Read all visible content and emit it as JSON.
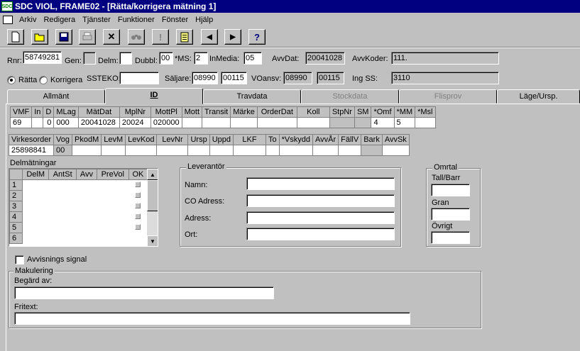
{
  "window": {
    "app_icon": "SDC",
    "title": "SDC VIOL, FRAME02 - [Rätta/korrigera mätning 1]"
  },
  "menu": [
    "Arkiv",
    "Redigera",
    "Tjänster",
    "Funktioner",
    "Fönster",
    "Hjälp"
  ],
  "toolbar": {
    "icons": [
      "new-document-icon",
      "open-folder-icon",
      "save-disk-icon",
      "print-icon",
      "delete-x-icon",
      "binoculars-icon",
      "exclamation-icon",
      "clipboard-icon",
      "arrow-left-icon",
      "arrow-right-icon",
      "help-question-icon"
    ],
    "glyphs": {
      "delete": "✕",
      "excl": "!",
      "prev": "◀",
      "next": "▶",
      "help": "?"
    }
  },
  "header": {
    "rnr_label": "Rnr:",
    "rnr_value": "58749281",
    "gen_label": "Gen:",
    "delm_label": "Delm:",
    "dubbl_label": "Dubbl:",
    "dubbl_value": "00",
    "ms_label": "*MS:",
    "ms_value": "2",
    "inmedia_label": "InMedia:",
    "inmedia_value": "05",
    "avvdat_label": "AvvDat:",
    "avvdat_value": "20041028",
    "avvkoder_label": "AvvKoder:",
    "avvkoder_value": "111.",
    "ratta_label": "Rätta",
    "korrigera_label": "Korrigera",
    "ssteko_label": "SSTEKO:",
    "ssteko_value": "",
    "saljare_label": "Säljare:",
    "saljare_value1": "08990",
    "saljare_value2": "00115",
    "voansv_label": "VOansv:",
    "voansv_value1": "08990",
    "voansv_value2": "00115",
    "ingss_label": "Ing SS:",
    "ingss_value": "3110"
  },
  "tabs": [
    {
      "label": "Allmänt",
      "state": "normal"
    },
    {
      "label": "ID",
      "state": "active"
    },
    {
      "label": "Travdata",
      "state": "normal"
    },
    {
      "label": "Stockdata",
      "state": "disabled"
    },
    {
      "label": "Flisprov",
      "state": "disabled"
    },
    {
      "label": "Läge/Ursp.",
      "state": "normal"
    }
  ],
  "grid1": {
    "headers": [
      "VMF",
      "In",
      "D",
      "MLag",
      "MätDat",
      "MplNr",
      "MottPl",
      "Mott",
      "Transit",
      "Märke",
      "OrderDat",
      "Koll",
      "StpNr",
      "SM",
      "*Omf",
      "*MM",
      "*Msl"
    ],
    "row": [
      "69",
      "",
      "0",
      "000",
      "20041028",
      "20024",
      "020000",
      "",
      "",
      "",
      "",
      "",
      "",
      "",
      "4",
      "5",
      ""
    ]
  },
  "grid2": {
    "headers": [
      "Virkesorder",
      "Vog",
      "PkodM",
      "LevM",
      "LevKod",
      "LevNr",
      "Ursp",
      "Uppd",
      "LKF",
      "To",
      "*Vskydd",
      "AvvÅr",
      "FällV",
      "Bark",
      "AvvSk"
    ],
    "row": [
      "25898841",
      "00",
      "",
      "",
      "",
      "",
      "",
      "",
      "",
      "",
      "",
      "",
      "",
      "",
      ""
    ]
  },
  "delmatningar": {
    "title": "Delmätningar",
    "headers": [
      "DelM",
      "AntSt",
      "Avv",
      "PreVol",
      "OK"
    ],
    "rows": [
      "1",
      "2",
      "3",
      "4",
      "5",
      "6"
    ]
  },
  "leverantor": {
    "title": "Leverantör",
    "namn_label": "Namn:",
    "co_label": "CO Adress:",
    "adress_label": "Adress:",
    "ort_label": "Ort:",
    "namn": "",
    "co": "",
    "adress": "",
    "ort": ""
  },
  "omrtal": {
    "title": "Omrtal",
    "tall_label": "Tall/Barr",
    "gran_label": "Gran",
    "ovrigt_label": "Övrigt"
  },
  "avvisning_label": "Avvisnings signal",
  "makulering": {
    "title": "Makulering",
    "begard_label": "Begärd av:",
    "fritext_label": "Fritext:",
    "begard": "",
    "fritext": ""
  }
}
